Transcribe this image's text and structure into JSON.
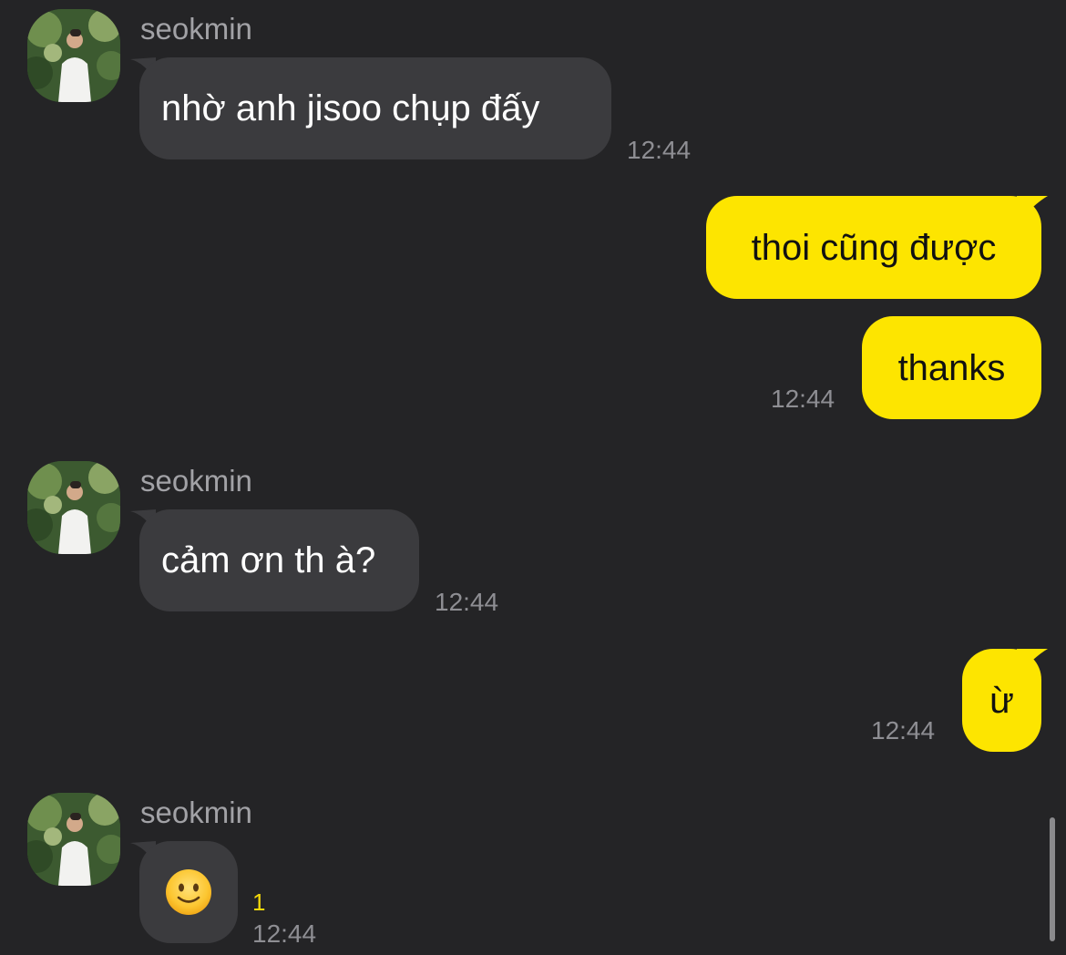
{
  "chat": {
    "messages": [
      {
        "sender": "seokmin",
        "text": "nhờ anh jisoo chụp đấy",
        "time": "12:44"
      },
      {
        "text": "thoi cũng được"
      },
      {
        "text": "thanks",
        "time": "12:44"
      },
      {
        "sender": "seokmin",
        "text": "cảm ơn th à?",
        "time": "12:44"
      },
      {
        "text": "ừ",
        "time": "12:44"
      },
      {
        "sender": "seokmin",
        "emoji": "slightly-smiling-face-icon",
        "unread": "1",
        "time": "12:44"
      }
    ]
  },
  "colors": {
    "background": "#242426",
    "incoming_bubble": "#3b3b3e",
    "outgoing_bubble": "#fde500",
    "unread_count": "#f5d90a"
  }
}
